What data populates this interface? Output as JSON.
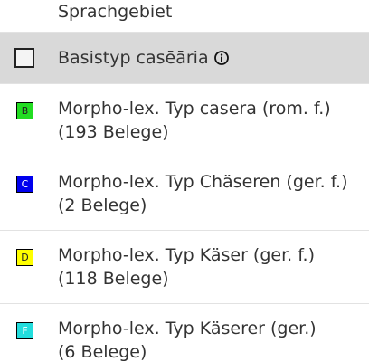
{
  "legend": {
    "header": "Sprachgebiet",
    "base_type": {
      "label": "Basistyp casēāria",
      "info_icon": "info-icon"
    },
    "items": [
      {
        "letter": "B",
        "color": "#22dd22",
        "text_color": "#222222",
        "line1": "Morpho-lex. Typ casera (rom. f.)",
        "line2": "(193 Belege)"
      },
      {
        "letter": "C",
        "color": "#0000ee",
        "text_color": "#ffffff",
        "line1": "Morpho-lex. Typ Chäseren (ger. f.)",
        "line2": "(2 Belege)"
      },
      {
        "letter": "D",
        "color": "#ffff00",
        "text_color": "#222222",
        "line1": "Morpho-lex. Typ Käser (ger. f.)",
        "line2": "(118 Belege)"
      },
      {
        "letter": "F",
        "color": "#22dddd",
        "text_color": "#ffffff",
        "line1": "Morpho-lex. Typ Käserer (ger.)",
        "line2": "(6 Belege)"
      }
    ]
  }
}
